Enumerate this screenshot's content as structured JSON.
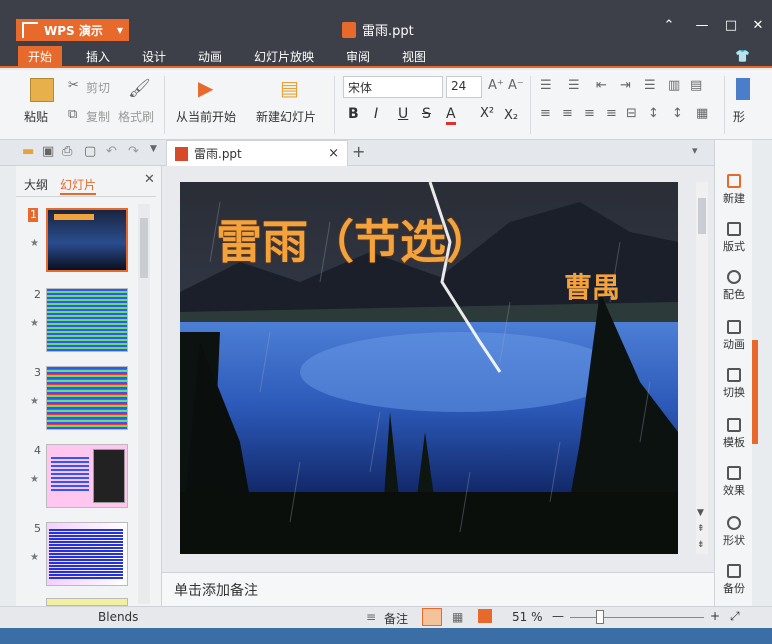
{
  "app": {
    "name": "WPS 演示",
    "doc_title": "雷雨.ppt"
  },
  "tabs": [
    "开始",
    "插入",
    "设计",
    "动画",
    "幻灯片放映",
    "审阅",
    "视图"
  ],
  "ribbon": {
    "paste": "粘贴",
    "cut": "剪切",
    "copy": "复制",
    "format_painter": "格式刷",
    "from_current": "从当前开始",
    "new_slide": "新建幻灯片",
    "font_name": "宋体",
    "font_size": "24",
    "bold": "B",
    "italic": "I",
    "underline": "U",
    "strike": "S",
    "font_color": "A",
    "superscript": "X²",
    "subscript": "X₂",
    "shape_label": "形"
  },
  "doc_tab": {
    "title": "雷雨.ppt",
    "close": "×",
    "add": "+"
  },
  "left_panel": {
    "tabs": [
      "大纲",
      "幻灯片"
    ],
    "slide_numbers": [
      "1",
      "2",
      "3",
      "4",
      "5"
    ]
  },
  "slide": {
    "title": "雷雨（节选）",
    "author": "曹禺"
  },
  "notes_placeholder": "单击添加备注",
  "right_panel": [
    "新建",
    "版式",
    "配色",
    "动画",
    "切换",
    "模板",
    "效果",
    "形状",
    "备份"
  ],
  "status": {
    "theme": "Blends",
    "notes_label": "备注",
    "zoom": "51 %"
  },
  "colors": {
    "accent": "#e8692c",
    "titlebar": "#3d4049",
    "slide_title": "#f4a23c"
  }
}
